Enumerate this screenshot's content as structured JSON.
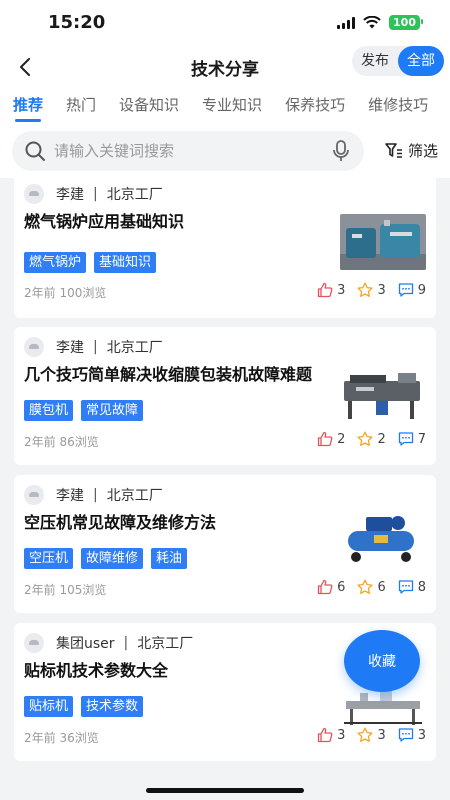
{
  "status": {
    "time": "15:20",
    "battery": "100"
  },
  "nav": {
    "title": "技术分享",
    "segments": [
      "发布",
      "全部"
    ]
  },
  "tabs": [
    "推荐",
    "热门",
    "设备知识",
    "专业知识",
    "保养技巧",
    "维修技巧"
  ],
  "search": {
    "placeholder": "请输入关键词搜索",
    "filter_label": "筛选"
  },
  "posts": [
    {
      "author": "李建",
      "company": "北京工厂",
      "title": "燃气锅炉应用基础知识",
      "tags": [
        "燃气锅炉",
        "基础知识"
      ],
      "time": "2年前",
      "views": "100浏览",
      "likes": "3",
      "stars": "3",
      "comments": "9"
    },
    {
      "author": "李建",
      "company": "北京工厂",
      "title": "几个技巧简单解决收缩膜包装机故障难题",
      "tags": [
        "膜包机",
        "常见故障"
      ],
      "time": "2年前",
      "views": "86浏览",
      "likes": "2",
      "stars": "2",
      "comments": "7"
    },
    {
      "author": "李建",
      "company": "北京工厂",
      "title": "空压机常见故障及维修方法",
      "tags": [
        "空压机",
        "故障维修",
        "耗油"
      ],
      "time": "2年前",
      "views": "105浏览",
      "likes": "6",
      "stars": "6",
      "comments": "8"
    },
    {
      "author": "集团user",
      "company": "北京工厂",
      "title": "贴标机技术参数大全",
      "tags": [
        "贴标机",
        "技术参数"
      ],
      "time": "2年前",
      "views": "36浏览",
      "likes": "3",
      "stars": "3",
      "comments": "3"
    }
  ],
  "fab": {
    "label": "收藏"
  },
  "colors": {
    "accent": "#1e7bf5",
    "tag": "#2f7ef6",
    "like": "#e8505b",
    "star": "#f5a623",
    "comment": "#1e7bf5"
  }
}
